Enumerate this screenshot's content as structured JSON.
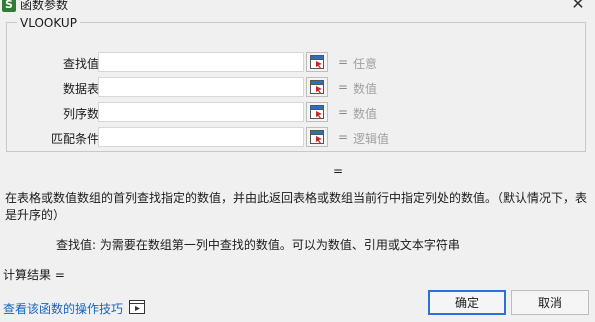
{
  "window": {
    "title": "函数参数",
    "app_icon": "S",
    "close": "✕"
  },
  "function": {
    "name": "VLOOKUP",
    "args": [
      {
        "label": "查找值",
        "value": "",
        "type": "任意"
      },
      {
        "label": "数据表",
        "value": "",
        "type": "数值"
      },
      {
        "label": "列序数",
        "value": "",
        "type": "数值"
      },
      {
        "label": "匹配条件",
        "value": "",
        "type": "逻辑值"
      }
    ],
    "eq_sign": "=",
    "result_eq": "="
  },
  "description": "在表格或数值数组的首列查找指定的数值，并由此返回表格或数组当前行中指定列处的数值。（默认情况下，表是升序的）",
  "param_description": "查找值:  为需要在数组第一列中查找的数值。可以为数值、引用或文本字符串",
  "calc_result": "计算结果  =",
  "footer": {
    "help_link": "查看该函数的操作技巧",
    "ok": "确定",
    "cancel": "取消"
  },
  "colors": {
    "accent": "#2b72d8",
    "link": "#1565c0",
    "app_icon_bg": "#2e7d32"
  },
  "icons": {
    "app": "wps-spreadsheet-icon",
    "range_picker": "range-select-icon",
    "video": "video-icon"
  }
}
